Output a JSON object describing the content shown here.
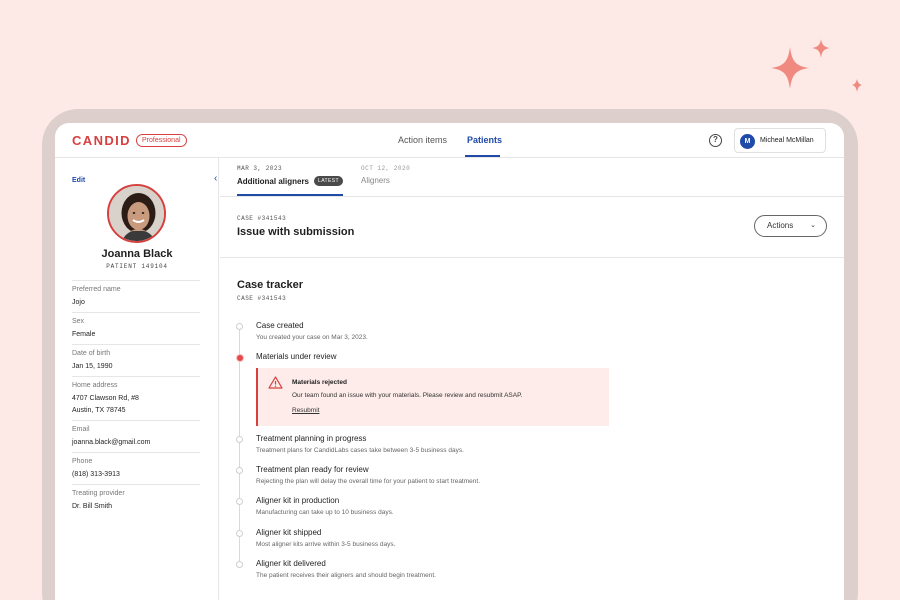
{
  "header": {
    "logo": "CANDID",
    "badge": "Professional",
    "nav": [
      "Action items",
      "Patients"
    ],
    "active_nav": "Patients",
    "help_icon": "question-circle-icon",
    "user": {
      "initial": "M",
      "name": "Micheal McMillan"
    }
  },
  "sidebar": {
    "edit_label": "Edit",
    "patient_name": "Joanna Black",
    "patient_id": "PATIENT 149104",
    "fields": [
      {
        "label": "Preferred name",
        "value": "Jojo"
      },
      {
        "label": "Sex",
        "value": "Female"
      },
      {
        "label": "Date of birth",
        "value": "Jan 15, 1990"
      },
      {
        "label": "Home address",
        "value": "4707 Clawson Rd, #8",
        "value2": "Austin, TX 78745"
      },
      {
        "label": "Email",
        "value": "joanna.black@gmail.com"
      },
      {
        "label": "Phone",
        "value": "(818) 313-3913"
      },
      {
        "label": "Treating provider",
        "value": "Dr. Bill Smith"
      }
    ]
  },
  "cases": [
    {
      "date": "MAR 3, 2023",
      "title": "Additional aligners",
      "badge": "LATEST"
    },
    {
      "date": "OCT 12, 2020",
      "title": "Aligners"
    }
  ],
  "case_header": {
    "case_number": "CASE #341543",
    "title": "Issue with submission",
    "actions_label": "Actions"
  },
  "tracker": {
    "title": "Case tracker",
    "case_number": "CASE #341543",
    "steps": [
      {
        "title": "Case created",
        "desc": "You created your case on Mar 3, 2023."
      },
      {
        "title": "Materials under review",
        "desc": ""
      },
      {
        "title": "Treatment planning in progress",
        "desc": "Treatment plans for CandidLabs cases take between 3-5 business days."
      },
      {
        "title": "Treatment plan ready for review",
        "desc": "Rejecting the plan will delay the overall time for your patient to start treatment."
      },
      {
        "title": "Aligner kit in production",
        "desc": "Manufacturing can take up to 10 business days."
      },
      {
        "title": "Aligner kit shipped",
        "desc": "Most aligner kits arrive within 3-5 business days."
      },
      {
        "title": "Aligner kit delivered",
        "desc": "The patient receives their aligners and should begin treatment."
      }
    ],
    "alert": {
      "title": "Materials rejected",
      "body": "Our team found an issue with your materials. Please review and resubmit ASAP.",
      "link": "Resubmit"
    }
  },
  "colors": {
    "brand": "#d6403f",
    "accent": "#1f4aa8",
    "background": "#fde9e5"
  }
}
